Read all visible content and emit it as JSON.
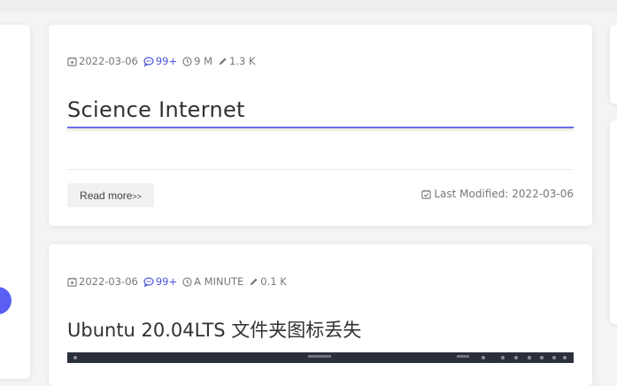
{
  "posts": [
    {
      "date": "2022-03-06",
      "comments": "99+",
      "read_time": "9 M",
      "word_count": "1.3 K",
      "title": "Science Internet",
      "read_more_label": "Read more",
      "read_more_arrows": ">>",
      "last_modified_label": "Last Modified: 2022-03-06"
    },
    {
      "date": "2022-03-06",
      "comments": "99+",
      "read_time": "A MINUTE",
      "word_count": "0.1 K",
      "title": "Ubuntu 20.04LTS 文件夹图标丢失"
    }
  ],
  "icons": {
    "date": "calendar-icon",
    "comments": "comment-bubble-icon",
    "read_time": "clock-icon",
    "word_count": "pencil-icon",
    "last_modified": "calendar-check-icon"
  },
  "colors": {
    "accent": "#5a5ef2",
    "comments_text": "#4a55d9",
    "title_text": "#303133",
    "meta_text": "#777777",
    "background": "#f4f4f4"
  }
}
